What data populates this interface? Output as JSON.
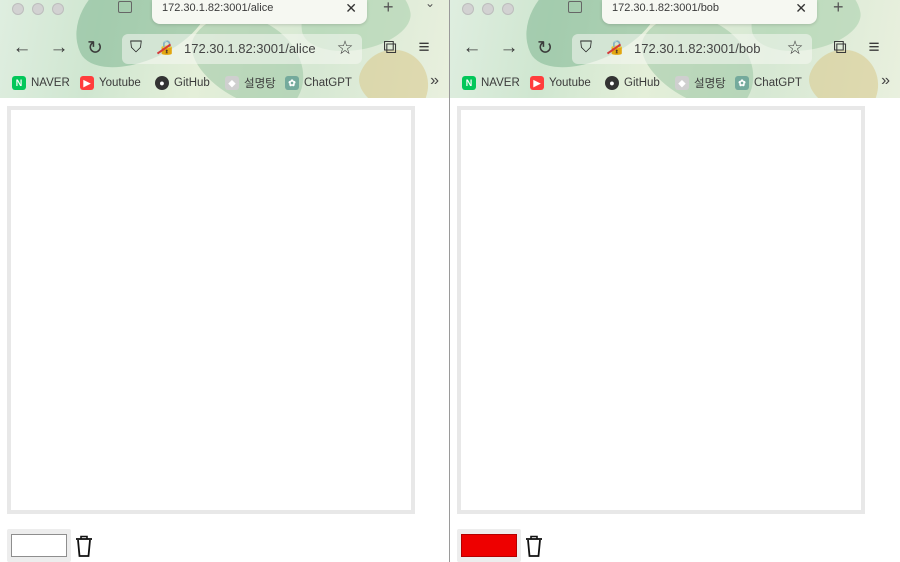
{
  "windows": [
    {
      "tab": {
        "title": "172.30.1.82:3001/alice"
      },
      "url": "172.30.1.82:3001/alice",
      "bookmarks": [
        {
          "label": "NAVER",
          "icon": "naver-icon",
          "color": "#03c75a",
          "glyph": "N"
        },
        {
          "label": "Youtube",
          "icon": "youtube-icon",
          "color": "#ff3d3d",
          "glyph": "▶"
        },
        {
          "label": "GitHub",
          "icon": "github-icon",
          "color": "#333333",
          "glyph": "●"
        },
        {
          "label": "설명탕",
          "icon": "seolmyeongtang-icon",
          "color": "#cfcfcf",
          "glyph": "◆"
        },
        {
          "label": "ChatGPT",
          "icon": "chatgpt-icon",
          "color": "#74aa9c",
          "glyph": "✿"
        }
      ],
      "selected_color": "#ffffff"
    },
    {
      "tab": {
        "title": "172.30.1.82:3001/bob"
      },
      "url": "172.30.1.82:3001/bob",
      "bookmarks": [
        {
          "label": "NAVER",
          "icon": "naver-icon",
          "color": "#03c75a",
          "glyph": "N"
        },
        {
          "label": "Youtube",
          "icon": "youtube-icon",
          "color": "#ff3d3d",
          "glyph": "▶"
        },
        {
          "label": "GitHub",
          "icon": "github-icon",
          "color": "#333333",
          "glyph": "●"
        },
        {
          "label": "설명탕",
          "icon": "seolmyeongtang-icon",
          "color": "#cfcfcf",
          "glyph": "◆"
        },
        {
          "label": "ChatGPT",
          "icon": "chatgpt-icon",
          "color": "#74aa9c",
          "glyph": "✿"
        }
      ],
      "selected_color": "#ee0000"
    }
  ],
  "icons": {
    "back": "←",
    "forward": "→",
    "reload": "↻",
    "shield": "⛉",
    "lock": "🔒",
    "star": "☆",
    "extensions": "⧉",
    "menu": "≡",
    "close": "✕",
    "new_tab": "+",
    "more": "»",
    "tabs_menu": "⌄"
  }
}
